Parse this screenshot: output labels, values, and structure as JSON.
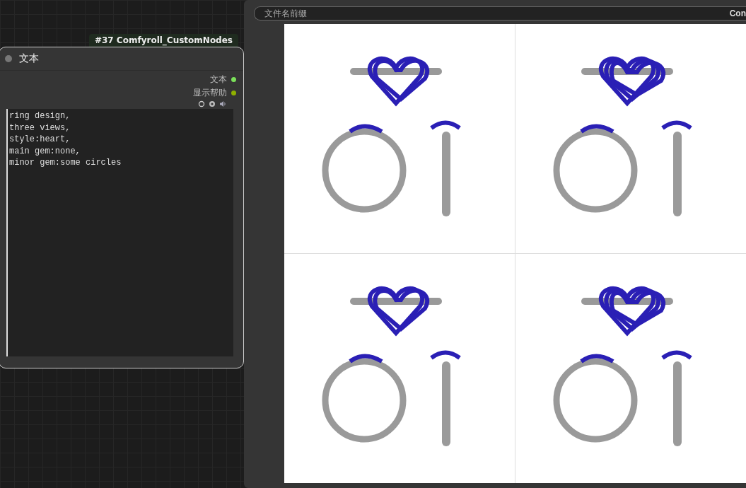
{
  "node": {
    "badge": "#37 Comfyroll_CustomNodes",
    "title": "文本",
    "outputs": [
      {
        "label": "文本",
        "color": "#7be05a"
      },
      {
        "label": "显示帮助",
        "color": "#8fb000"
      }
    ],
    "text": "ring design,\nthree views,\nstyle:heart,\nmain gem:none,\nminor gem:some circles"
  },
  "preview": {
    "field": {
      "label": "文件名前缀",
      "value": "Con"
    }
  }
}
